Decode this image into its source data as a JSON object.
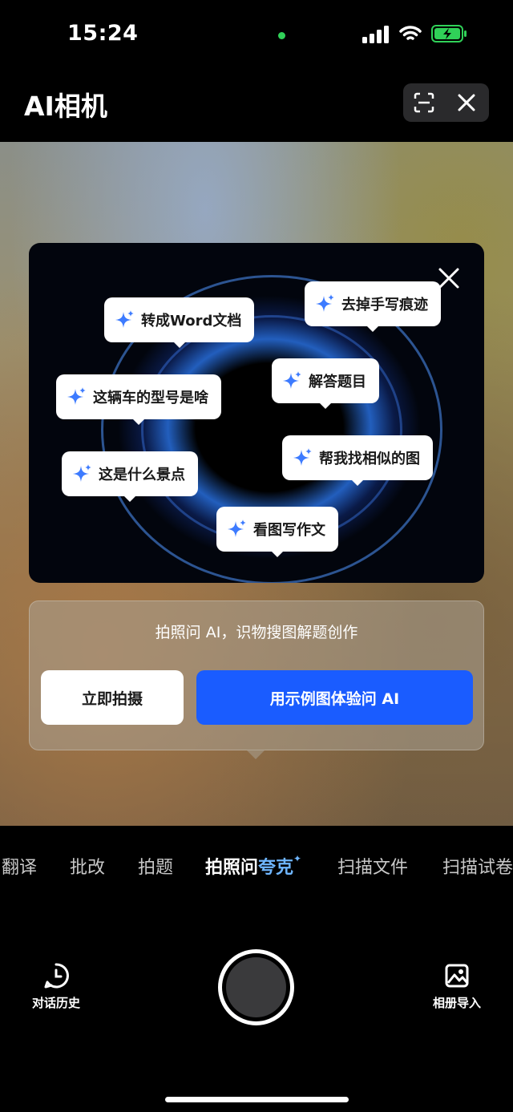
{
  "status_bar": {
    "time": "15:24"
  },
  "header": {
    "title": "AI相机"
  },
  "promo": {
    "suggestions": [
      "转成Word文档",
      "去掉手写痕迹",
      "这辆车的型号是啥",
      "解答题目",
      "这是什么景点",
      "帮我找相似的图",
      "看图写作文"
    ]
  },
  "info_card": {
    "text": "拍照问 AI，识物搜图解题创作",
    "shoot_label": "立即拍摄",
    "sample_label": "用示例图体验问 AI"
  },
  "modes": {
    "items": [
      "翻译",
      "批改",
      "拍题",
      "扫描文件",
      "扫描试卷"
    ],
    "active_prefix": "拍照问",
    "active_brand": "夸克",
    "active_star": "✦"
  },
  "bottom": {
    "history_label": "对话历史",
    "album_label": "相册导入"
  },
  "colors": {
    "accent_blue": "#1a5cff",
    "brand_blue": "#6fb6ff",
    "spark_blue": "#3d7bff"
  }
}
